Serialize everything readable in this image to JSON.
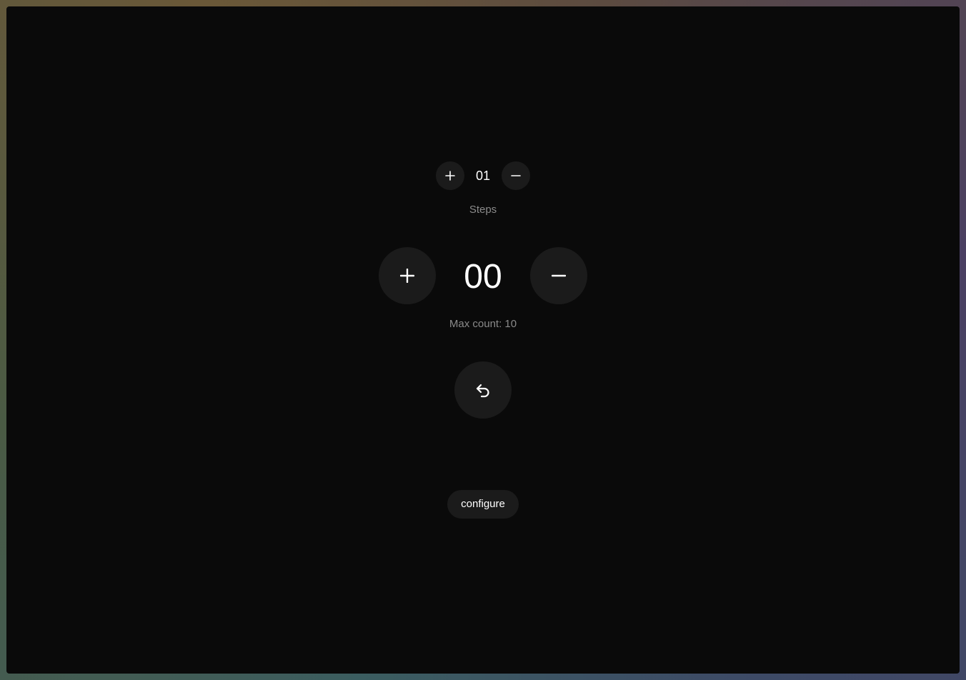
{
  "steps": {
    "value": "01",
    "label": "Steps",
    "increment_icon": "plus-icon",
    "decrement_icon": "minus-icon"
  },
  "counter": {
    "value": "00",
    "max_label": "Max count: 10",
    "increment_icon": "plus-icon",
    "decrement_icon": "minus-icon"
  },
  "reset": {
    "icon": "undo-icon"
  },
  "configure": {
    "label": "configure"
  },
  "colors": {
    "background": "#0a0a0a",
    "button": "#1b1b1b",
    "text": "#ffffff",
    "muted_text": "#8a8a8a"
  }
}
